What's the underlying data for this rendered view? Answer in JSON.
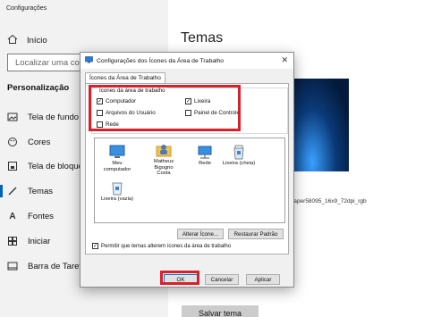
{
  "app_title": "Configurações",
  "sidebar": {
    "home_label": "Início",
    "search_placeholder": "Localizar uma configuração",
    "section_heading": "Personalização",
    "items": [
      {
        "label": "Tela de fundo",
        "icon": "image-icon"
      },
      {
        "label": "Cores",
        "icon": "palette-icon"
      },
      {
        "label": "Tela de bloqueio",
        "icon": "lock-screen-icon"
      },
      {
        "label": "Temas",
        "icon": "brush-icon",
        "selected": true
      },
      {
        "label": "Fontes",
        "icon": "font-icon"
      },
      {
        "label": "Iniciar",
        "icon": "start-icon"
      },
      {
        "label": "Barra de Tarefas",
        "icon": "taskbar-icon"
      }
    ]
  },
  "main": {
    "title": "Temas",
    "partial_label": "o",
    "wallpaper_name": "ıllpaper58095_16x9_72dpi_rgb",
    "save_theme": "Salvar tema"
  },
  "dialog": {
    "title": "Configurações dos Ícones da Área de Trabalho",
    "close": "✕",
    "tab": "Ícones da Área de Trabalho",
    "group_label": "Ícones da área de trabalho",
    "checkboxes": [
      {
        "label": "Computador",
        "checked": true
      },
      {
        "label": "Lixeira",
        "checked": true
      },
      {
        "label": "Arquivos do Usuário",
        "checked": false
      },
      {
        "label": "Painel de Controle",
        "checked": false
      },
      {
        "label": "Rede",
        "checked": false
      }
    ],
    "icons": [
      {
        "label": "Meu computador"
      },
      {
        "label": "Matheus Bigogno Costa"
      },
      {
        "label": "Rede"
      },
      {
        "label": "Lixeira (cheia)"
      },
      {
        "label": "Lixeira (vazia)"
      }
    ],
    "change_icon": "Alterar Ícone...",
    "restore_default": "Restaurar Padrão",
    "allow_themes": "Permitir que temas alterem ícones da área de trabalho",
    "allow_themes_checked": true,
    "ok": "OK",
    "cancel": "Cancelar",
    "apply": "Aplicar"
  }
}
